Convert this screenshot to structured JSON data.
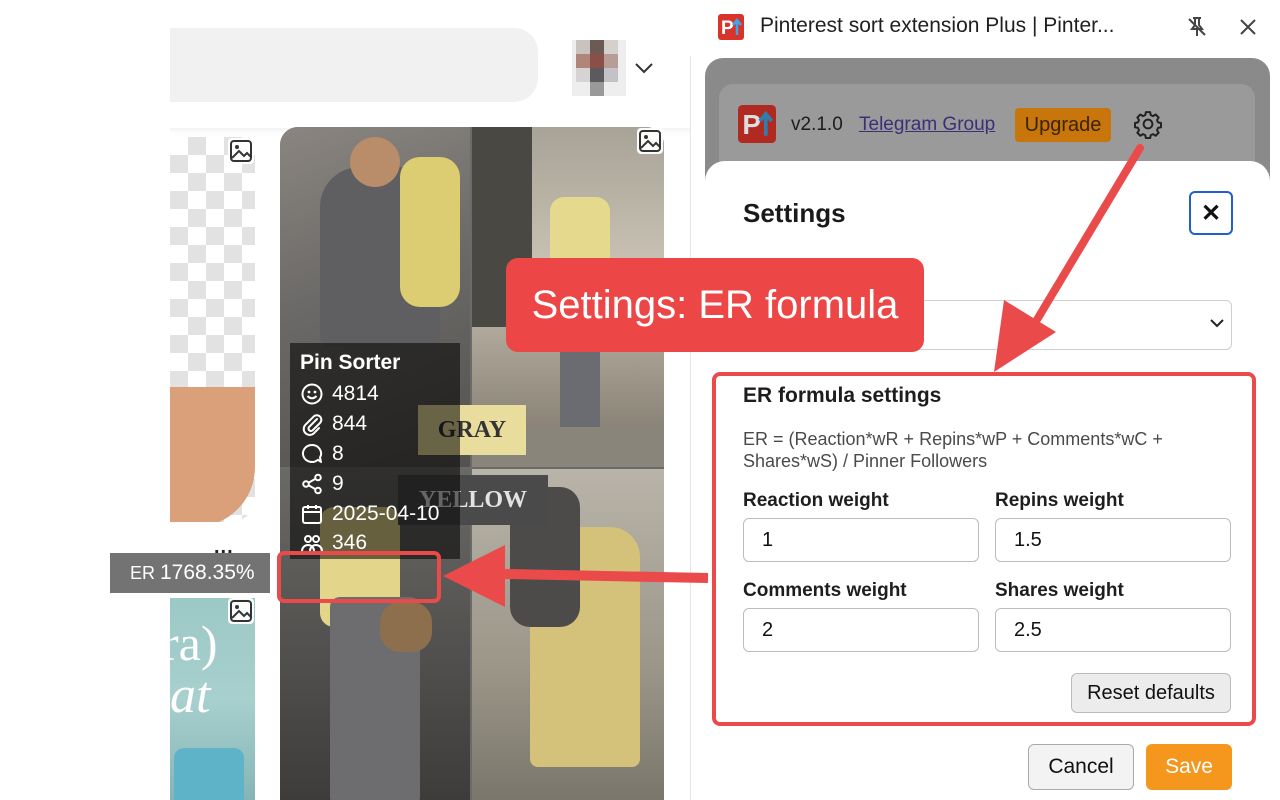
{
  "extension": {
    "title": "Pinterest sort extension Plus | Pinter...",
    "version": "v2.1.0",
    "telegram_link": "Telegram Group",
    "upgrade_label": "Upgrade"
  },
  "pin_sorter": {
    "title": "Pin Sorter",
    "reactions": "4814",
    "repins": "844",
    "comments": "8",
    "shares": "9",
    "date": "2025-04-10",
    "followers": "346",
    "er_label": "ER",
    "er_value": "1768.35%"
  },
  "pin_image_text": {
    "gray": "GRAY",
    "yellow": "YELLOW"
  },
  "left_card": {
    "more_label": "...",
    "text_top": "ra)",
    "text_bottom": "at"
  },
  "settings": {
    "title": "Settings",
    "close_label": "✕",
    "er_section_title": "ER formula settings",
    "er_formula": "ER = (Reaction*wR + Repins*wP + Comments*wC + Shares*wS) / Pinner Followers",
    "fields": [
      {
        "label": "Reaction weight",
        "value": "1"
      },
      {
        "label": "Repins weight",
        "value": "1.5"
      },
      {
        "label": "Comments weight",
        "value": "2"
      },
      {
        "label": "Shares weight",
        "value": "2.5"
      }
    ],
    "reset_label": "Reset defaults",
    "cancel_label": "Cancel",
    "save_label": "Save"
  },
  "annotation": {
    "callout": "Settings: ER formula"
  },
  "colors": {
    "accent_red": "#ea4a4a",
    "save_orange": "#f5961d",
    "upgrade_orange": "#c8750c",
    "focus_blue": "#1f5fd1"
  },
  "icons": [
    "image-icon",
    "chevron-down-icon",
    "smiley-icon",
    "paperclip-icon",
    "comment-icon",
    "share-icon",
    "calendar-icon",
    "people-icon",
    "pin-icon",
    "close-icon",
    "gear-icon",
    "pinterest-logo-icon"
  ]
}
